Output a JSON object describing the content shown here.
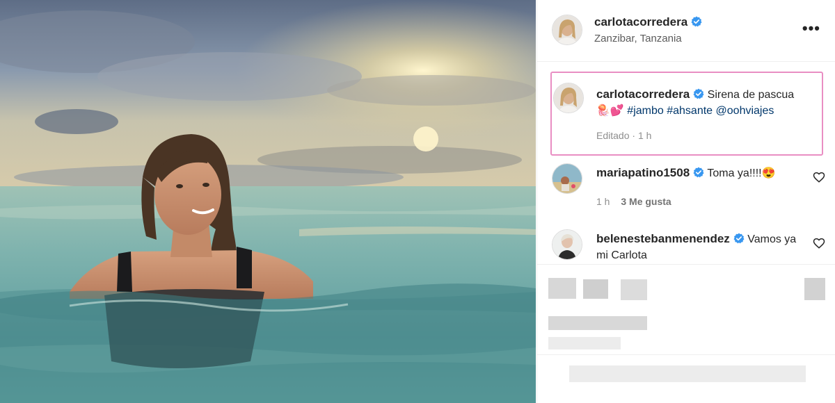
{
  "post": {
    "author": "carlotacorredera",
    "location": "Zanzibar, Tanzania",
    "more_icon": "more-options-icon",
    "caption": {
      "username": "carlotacorredera",
      "text": "Sirena de pascua",
      "emojis": "🪼💕",
      "hashtags": [
        "#jambo",
        "#ahsante"
      ],
      "mention": "@oohviajes",
      "edited_label": "Editado",
      "time": "1 h"
    },
    "comments": [
      {
        "username": "mariapatino1508",
        "text": "Toma ya!!!!😍",
        "time": "1 h",
        "likes": "3 Me gusta"
      },
      {
        "username": "belenestebanmenendez",
        "text": "Vamos ya mi Carlota"
      }
    ]
  },
  "colors": {
    "verified": "#3897f0",
    "highlight_border": "#e98ec3",
    "hashtag": "#00376b",
    "meta": "#8e8e8e"
  }
}
